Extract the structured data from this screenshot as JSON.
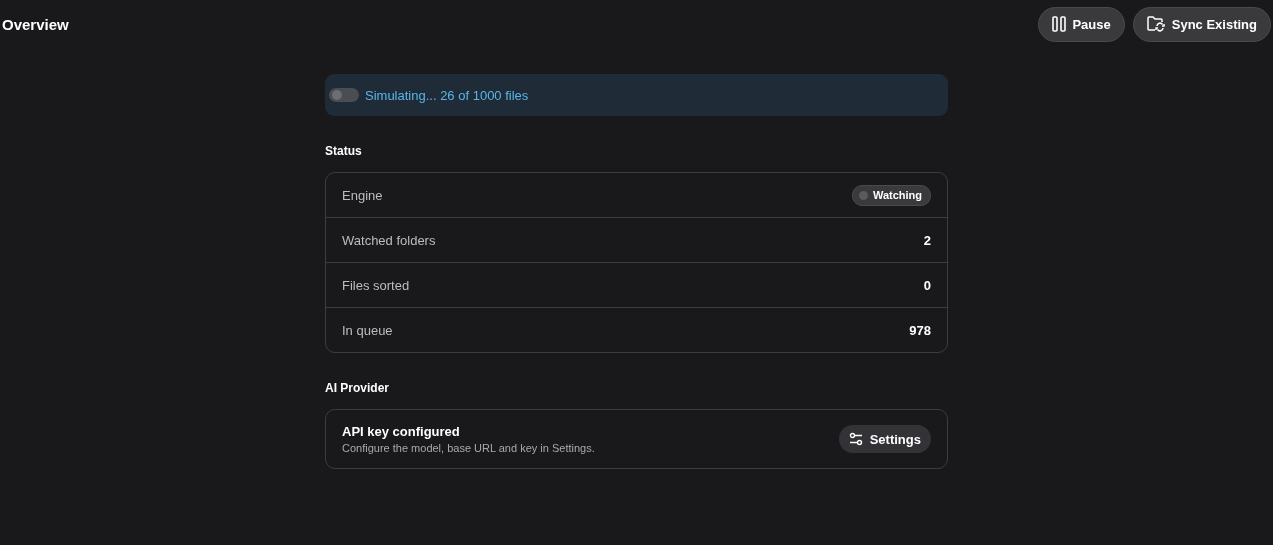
{
  "header": {
    "title": "Overview",
    "actions": [
      {
        "kind": "pause",
        "label": "Pause"
      },
      {
        "kind": "sync",
        "label": "Sync Existing"
      }
    ]
  },
  "banner": {
    "text": "Simulating... 26 of 1000 files"
  },
  "status": {
    "heading": "Status",
    "rows": [
      {
        "label": "Engine",
        "kind": "badge",
        "value": "Watching"
      },
      {
        "label": "Watched folders",
        "kind": "number",
        "value": "2"
      },
      {
        "label": "Files sorted",
        "kind": "number",
        "value": "0"
      },
      {
        "label": "In queue",
        "kind": "number",
        "value": "978"
      }
    ]
  },
  "ai_provider": {
    "heading": "AI Provider",
    "title": "API key configured",
    "description": "Configure the model, base URL and key in Settings.",
    "button": "Settings"
  }
}
